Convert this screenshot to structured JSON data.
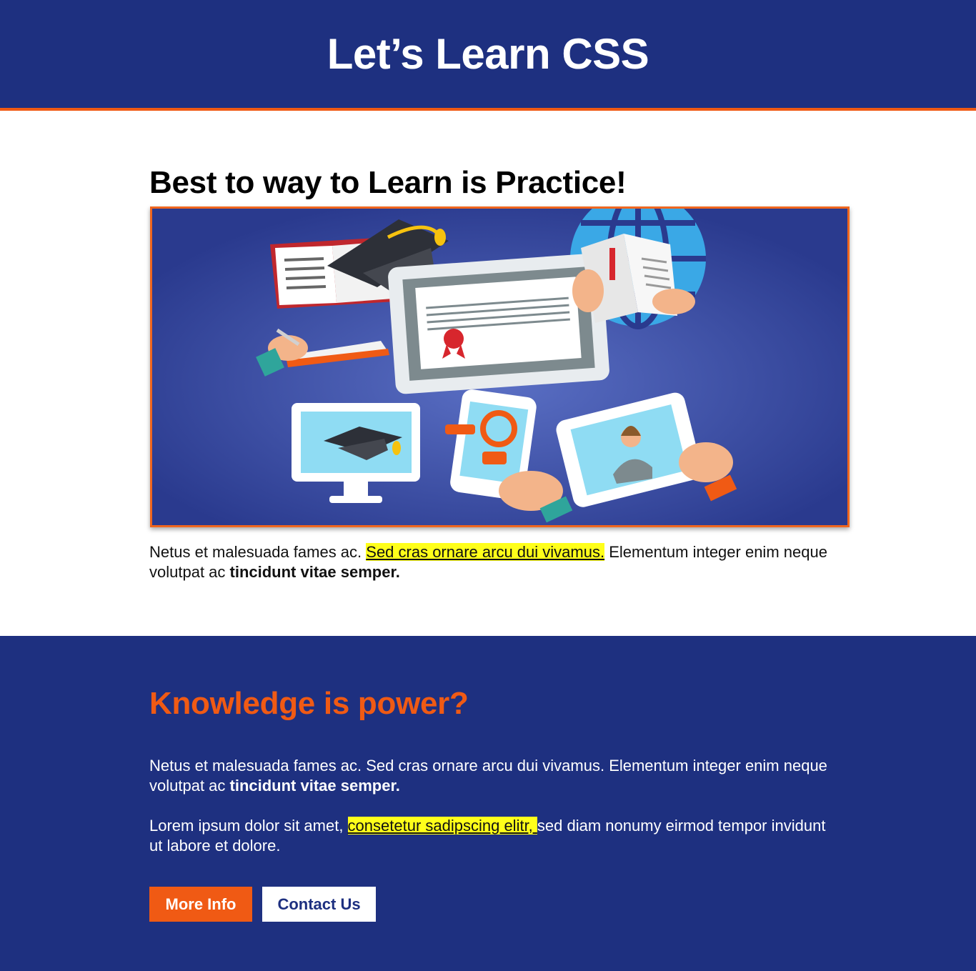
{
  "header": {
    "title": "Let’s Learn CSS"
  },
  "hero": {
    "heading": "Best to way to Learn is Practice!",
    "image_icon": "online-education-illustration",
    "lead": {
      "text_before": "Netus et malesuada fames ac. ",
      "highlight": "Sed cras ornare arcu dui vivamus.",
      "text_after": " Elementum integer enim neque volutpat ac ",
      "bold": "tincidunt vitae semper."
    }
  },
  "knowledge": {
    "heading": "Knowledge is power?",
    "p1": {
      "text": "Netus et malesuada fames ac. Sed cras ornare arcu dui vivamus. Elementum integer enim neque volutpat ac ",
      "bold": "tincidunt vitae semper."
    },
    "p2": {
      "text_before": "Lorem ipsum dolor sit amet, ",
      "highlight": "consetetur sadipscing elitr, ",
      "text_after": "sed diam nonumy eirmod tempor invidunt ut labore et dolore."
    },
    "buttons": {
      "more_info": "More Info",
      "contact_us": "Contact Us"
    }
  },
  "colors": {
    "primary_blue": "#1e3080",
    "accent_orange": "#f05a14",
    "highlight_yellow": "#ffff1a"
  }
}
